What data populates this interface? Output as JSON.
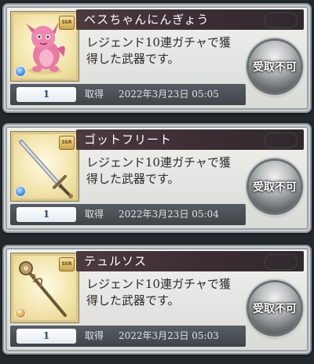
{
  "items": [
    {
      "name": "ベスちゃんにんぎょう",
      "description_line1": "レジェンド10連ガチャで獲",
      "description_line2": "得した武器です。",
      "status": "受取不可",
      "quantity": "1",
      "acquired_label": "取得",
      "acquired_date": "2022年3月23日 05:05",
      "icon": "pink-dragon-doll-icon",
      "element_color": "#3b8fe0"
    },
    {
      "name": "ゴットフリート",
      "description_line1": "レジェンド10連ガチャで獲",
      "description_line2": "得した武器です。",
      "status": "受取不可",
      "quantity": "1",
      "acquired_label": "取得",
      "acquired_date": "2022年3月23日 05:04",
      "icon": "greatsword-icon",
      "element_color": "#3b8fe0"
    },
    {
      "name": "テュルソス",
      "description_line1": "レジェンド10連ガチャで獲",
      "description_line2": "得した武器です。",
      "status": "受取不可",
      "quantity": "1",
      "acquired_label": "取得",
      "acquired_date": "2022年3月23日 05:03",
      "icon": "staff-icon",
      "element_color": "#d9b25a"
    }
  ]
}
